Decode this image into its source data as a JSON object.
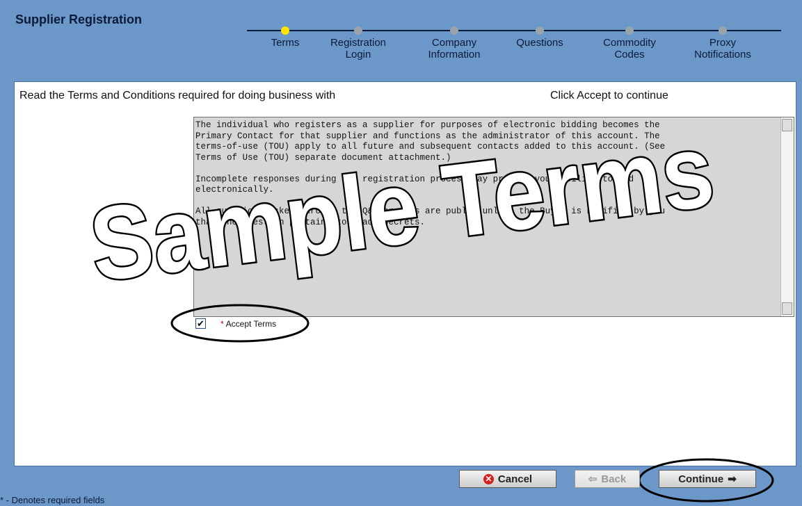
{
  "header": {
    "title": "Supplier Registration"
  },
  "steps": [
    {
      "label": "Terms",
      "active": true
    },
    {
      "label": "Registration\nLogin",
      "active": false
    },
    {
      "label": "Company\nInformation",
      "active": false
    },
    {
      "label": "Questions",
      "active": false
    },
    {
      "label": "Commodity\nCodes",
      "active": false
    },
    {
      "label": "Proxy\nNotifications",
      "active": false
    }
  ],
  "main": {
    "instruction": "Read the Terms and Conditions required for doing business with",
    "instruction_right": "Click Accept to continue",
    "terms_paragraphs": [
      "The individual who registers as a supplier for purposes of electronic bidding becomes the\nPrimary Contact for that supplier and functions as the administrator of this account. The\nterms-of-use (TOU) apply to all future and subsequent contacts added to this account. (See\nTerms of Use (TOU) separate document attachment.)",
      "Incomplete responses during the registration process may prevent your ability to bid\nelectronically.",
      "All questions asked through the Q&A process are public unless the Buyer is notified by you\nthat the question pertains to trade secrets."
    ],
    "accept": {
      "required_marker": "*",
      "label": "Accept Terms",
      "checked": true
    }
  },
  "watermark": {
    "text": "Sample Terms"
  },
  "buttons": {
    "cancel": "Cancel",
    "back": "Back",
    "continue": "Continue"
  },
  "footer": {
    "note": "* - Denotes required fields"
  }
}
